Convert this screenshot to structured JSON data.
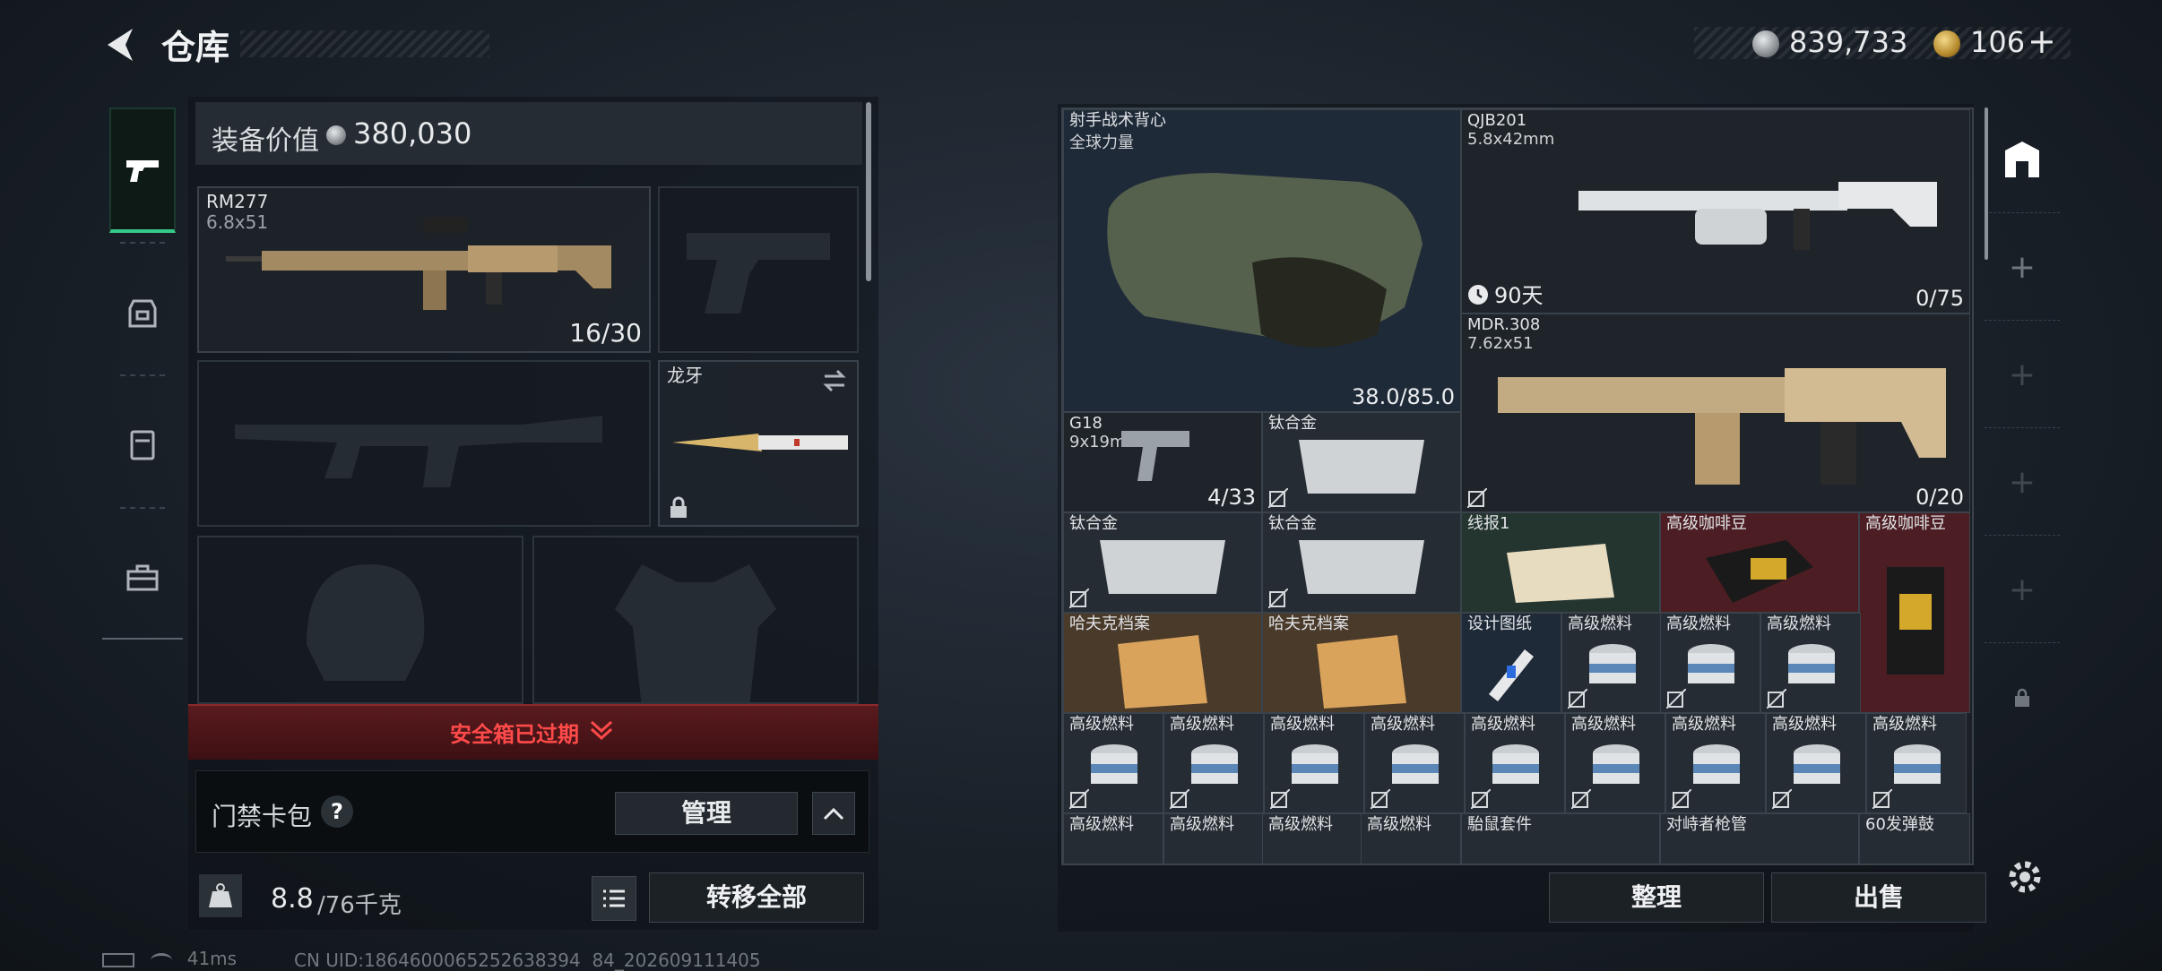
{
  "header": {
    "title": "仓库"
  },
  "currency": {
    "silver": "839,733",
    "gold": "106",
    "gold_add": "+"
  },
  "left": {
    "equip_value_label": "装备价值",
    "equip_value": "380,030",
    "slots": {
      "primary": {
        "name": "RM277",
        "caliber": "6.8x51",
        "ammo": "16/30"
      },
      "melee": {
        "name": "龙牙"
      }
    },
    "safe_box_status": "安全箱已过期",
    "keycard_label": "门禁卡包",
    "keycard_help": "?",
    "manage_label": "管理",
    "weight_value": "8.8",
    "weight_max": "/76千克",
    "transfer_all_label": "转移全部"
  },
  "status": {
    "ping": "41ms",
    "uid": "CN UID:1864600065252638394 84_202609111405"
  },
  "stash": {
    "items": [
      {
        "name": "射手战术背心",
        "sub": "全球力量",
        "count": "38.0/85.0"
      },
      {
        "name": "QJB201",
        "sub": "5.8x42mm",
        "timer": "90天",
        "count": "0/75"
      },
      {
        "name": "MDR.308",
        "sub": "7.62x51",
        "count": "0/20"
      },
      {
        "name": "G18",
        "sub": "9x19mm",
        "count": "4/33"
      },
      {
        "name": "钛合金"
      },
      {
        "name": "钛合金"
      },
      {
        "name": "钛合金"
      },
      {
        "name": "线报1"
      },
      {
        "name": "高级咖啡豆"
      },
      {
        "name": "高级咖啡豆"
      },
      {
        "name": "哈夫克档案"
      },
      {
        "name": "哈夫克档案"
      },
      {
        "name": "设计图纸"
      },
      {
        "name": "高级燃料"
      },
      {
        "name": "駘鼠套件"
      },
      {
        "name": "对峙者枪管"
      },
      {
        "name": "60发弹鼓"
      }
    ],
    "fuel_label": "高级燃料",
    "sort_label": "整理",
    "sell_label": "出售"
  }
}
